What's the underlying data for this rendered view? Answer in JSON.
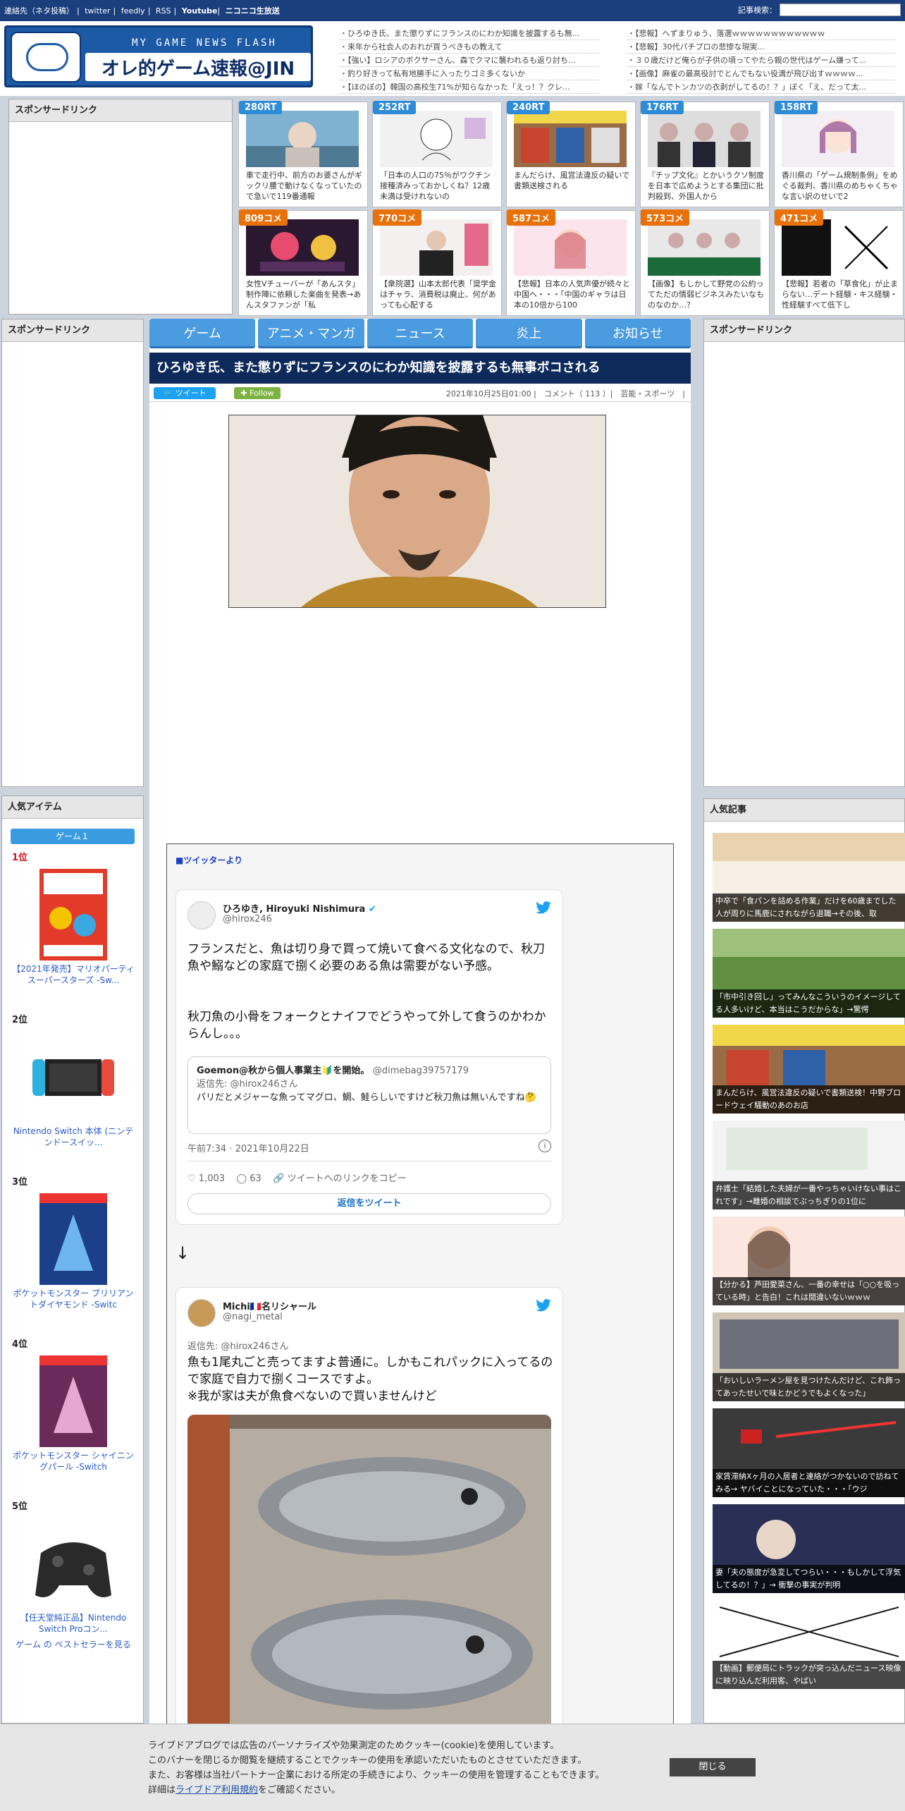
{
  "topbar": {
    "links": [
      "連絡先（ネタ投稿）",
      "twitter",
      "feedly",
      "RSS",
      "Youtube",
      "ニコニコ生放送"
    ],
    "search_label": "記事検索："
  },
  "logo": {
    "sub": "MY GAME NEWS FLASH",
    "main": "オレ的ゲーム速報@JIN"
  },
  "headlines_left": [
    "ひろゆき氏、また懲りずにフランスのにわか知識を披露するも無...",
    "来年から社会人のおれが買うべきもの教えて",
    "【強い】ロシアのボクサーさん、森でクマに襲われるも返り討ち...",
    "釣り好きって私有地勝手に入ったりゴミ多くないか",
    "【ほのぼの】韓国の高校生71%が知らなかった「えっ！？クレ..."
  ],
  "headlines_right": [
    "【悲報】へずまりゅう、落選ｗｗｗｗｗｗｗｗｗｗｗｗ",
    "【悲報】30代パチプロの悲惨な現実...",
    "３０歳だけど俺らが子供の頃ってやたら親の世代はゲーム嫌って...",
    "【画像】麻雀の最高役討でとんでもない役満が飛び出すｗｗｗｗ...",
    "嫁「なんでトンカツの衣剥がしてるの！？」ぼく「え、だって太..."
  ],
  "sponsor": "スポンサードリンク",
  "cards": [
    {
      "badge": "280RT",
      "type": "rt",
      "text": "車で走行中、前方のお婆さんがギックリ腰で動けなくなっていたので急いで119番通報"
    },
    {
      "badge": "252RT",
      "type": "rt",
      "text": "「日本の人口の75％がワクチン接種済みっておかしくね？12歳未満は受けれないの"
    },
    {
      "badge": "240RT",
      "type": "rt",
      "text": "まんだらけ、風営法違反の疑いで書類送検される"
    },
    {
      "badge": "176RT",
      "type": "rt",
      "text": "『チップ文化』とかいうクソ制度を日本で広めようとする集団に批判殺到、外国人から"
    },
    {
      "badge": "158RT",
      "type": "rt",
      "text": "香川県の「ゲーム規制条例」をめぐる裁判、香川県のめちゃくちゃな言い訳のせいで2"
    },
    {
      "badge": "809コメ",
      "type": "cm",
      "text": "女性Vチューバーが「あんスタ」制作陣に依頼した楽曲を発表→あんスタファンが「私"
    },
    {
      "badge": "770コメ",
      "type": "cm",
      "text": "【衆院選】山本太郎代表「奨学金はチャラ、消費税は廃止、何があっても心配する"
    },
    {
      "badge": "587コメ",
      "type": "cm",
      "text": "【悲報】日本の人気声優が続々と中国へ・・・「中国のギャラは日本の10倍から100"
    },
    {
      "badge": "573コメ",
      "type": "cm",
      "text": "【画像】もしかして野党の公約ってただの情弱ビジネスみたいなものなのか…？"
    },
    {
      "badge": "471コメ",
      "type": "cm",
      "text": "【悲報】若者の「草食化」が止まらない…デート経験・キス経験・性経験すべて低下し"
    }
  ],
  "nav": [
    "ゲーム",
    "アニメ・マンガ",
    "ニュース",
    "炎上",
    "お知らせ"
  ],
  "article": {
    "title": "ひろゆき氏、また懲りずにフランスのにわか知識を披露するも無事ボコされる",
    "tweet_btn": "ツイート",
    "follow_btn": "Follow",
    "meta": "2021年10月25日01:00 |　コメント（ 113 ）|　芸能・スポーツ　|"
  },
  "twitter_box": {
    "header": "■ツイッターより",
    "arrow": "↓",
    "tweet1": {
      "name": "ひろゆき, Hiroyuki Nishimura",
      "handle": "@hirox246",
      "body1": "フランスだと、魚は切り身で買って焼いて食べる文化なので、秋刀魚や鰯などの家庭で捌く必要のある魚は需要がない予感。",
      "body2": "秋刀魚の小骨をフォークとナイフでどうやって外して食うのかわからんし。。。",
      "quote_name": "Goemon@秋から個人事業主🔰を開始。",
      "quote_handle": "@dimebag39757179",
      "quote_reply": "返信先: @hirox246さん",
      "quote_body": "パリだとメジャーな魚ってマグロ、鯛、鮭らしいですけど秋刀魚は無いんですね🤔",
      "time": "午前7:34 · 2021年10月22日",
      "likes": "1,003",
      "replies": "63",
      "copy": "ツイートへのリンクをコピー",
      "reply_btn": "返信をツイート"
    },
    "tweet2": {
      "name": "Michi🇫🇷名リシャール",
      "handle": "@nagi_metal",
      "reply_to": "返信先: @hirox246さん",
      "body": "魚も1尾丸ごと売ってますよ普通に。しかもこれパックに入ってるので家庭で自力で捌くコースですよ。\n※我が家は夫が魚食べないので買いませんけど"
    }
  },
  "popular_items": {
    "title": "人気アイテム",
    "tab": "ゲーム１",
    "items": [
      {
        "rank": "1位",
        "name": "【2021年発売】マリオパーティ スーパースターズ -Sw..."
      },
      {
        "rank": "2位",
        "name": "Nintendo Switch 本体 (ニンテンドースイッ..."
      },
      {
        "rank": "3位",
        "name": "ポケットモンスター ブリリアントダイヤモンド -Switc"
      },
      {
        "rank": "4位",
        "name": "ポケットモンスター シャイニングパール -Switch"
      },
      {
        "rank": "5位",
        "name": "【任天堂純正品】Nintendo Switch Proコン..."
      }
    ],
    "bestseller": "ゲーム の ベストセラーを見る"
  },
  "popular_articles": {
    "title": "人気記事",
    "items": [
      "中卒で「食パンを詰める作業」だけを60歳までした人が周りに馬鹿にされながら退職→その後、取",
      "「市中引き回し」ってみんなこういうのイメージしてる人多いけど、本当はこうだからな」→驚愕",
      "まんだらけ、風営法違反の疑いで書類送検！中野ブロードウェイ騒動のあのお店",
      "弁護士「結婚した夫婦が一番やっちゃいけない事はこれです」→離婚の相談でぶっちぎりの1位に",
      "【分かる】芦田愛菜さん、一番の幸せは「○○を吸っている時」と告白！これは間違いないｗｗｗ",
      "「おいしいラーメン屋を見つけたんだけど、これ飾ってあったせいで味とかどうでもよくなった」",
      "家賃滞納Xヶ月の入居者と連絡がつかないので訪ねてみる→ ヤバイことになっていた・・・「ウジ",
      "妻「夫の態度が急変してつらい・・・もしかして浮気してるの！？」→ 衝撃の事実が判明",
      "【動画】郵便局にトラックが突っ込んだニュース映像に映り込んだ利用客、やばい"
    ]
  },
  "cookie": {
    "line1": "ライブドアブログでは広告のパーソナライズや効果測定のためクッキー(cookie)を使用しています。",
    "line2": "このバナーを閉じるか閲覧を継続することでクッキーの使用を承認いただいたものとさせていただきます。",
    "line3": "また、お客様は当社パートナー企業における所定の手続きにより、クッキーの使用を管理することもできます。",
    "line4_pre": "詳細は",
    "line4_link": "ライブドア利用規約",
    "line4_post": "をご確認ください。",
    "close": "閉じる"
  }
}
